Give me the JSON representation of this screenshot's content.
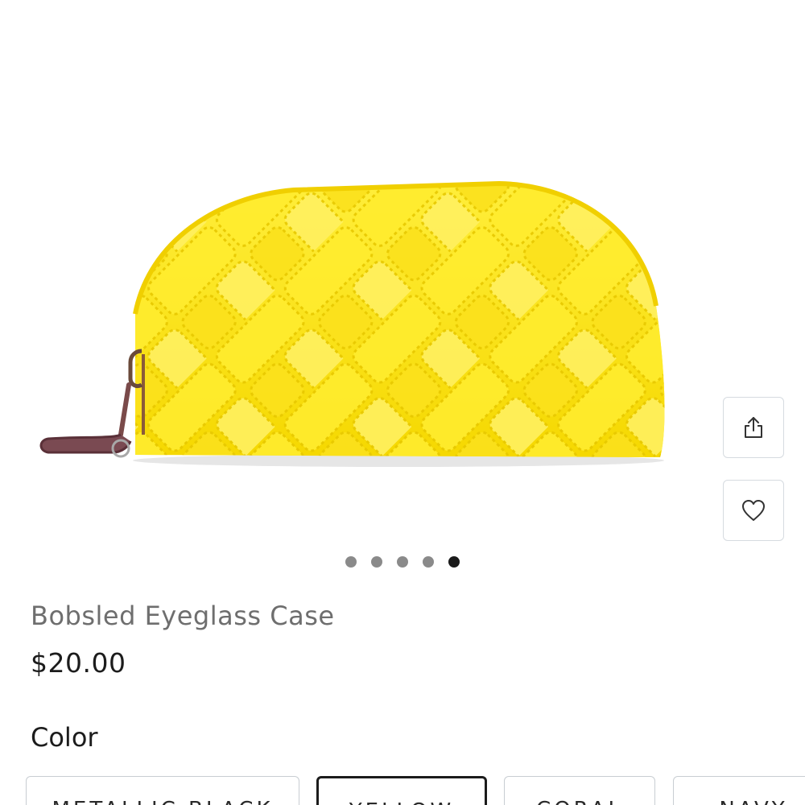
{
  "product": {
    "title": "Bobsled Eyeglass Case",
    "price": "$20.00",
    "main_color": "#fbe11c"
  },
  "actions": {
    "share_icon": "share-icon",
    "favorite_icon": "heart-icon"
  },
  "carousel": {
    "total": 5,
    "active_index": 5
  },
  "color": {
    "label": "Color",
    "options": [
      "METALLIC BLACK",
      "YELLOW",
      "CORAL",
      "NAVY"
    ]
  }
}
